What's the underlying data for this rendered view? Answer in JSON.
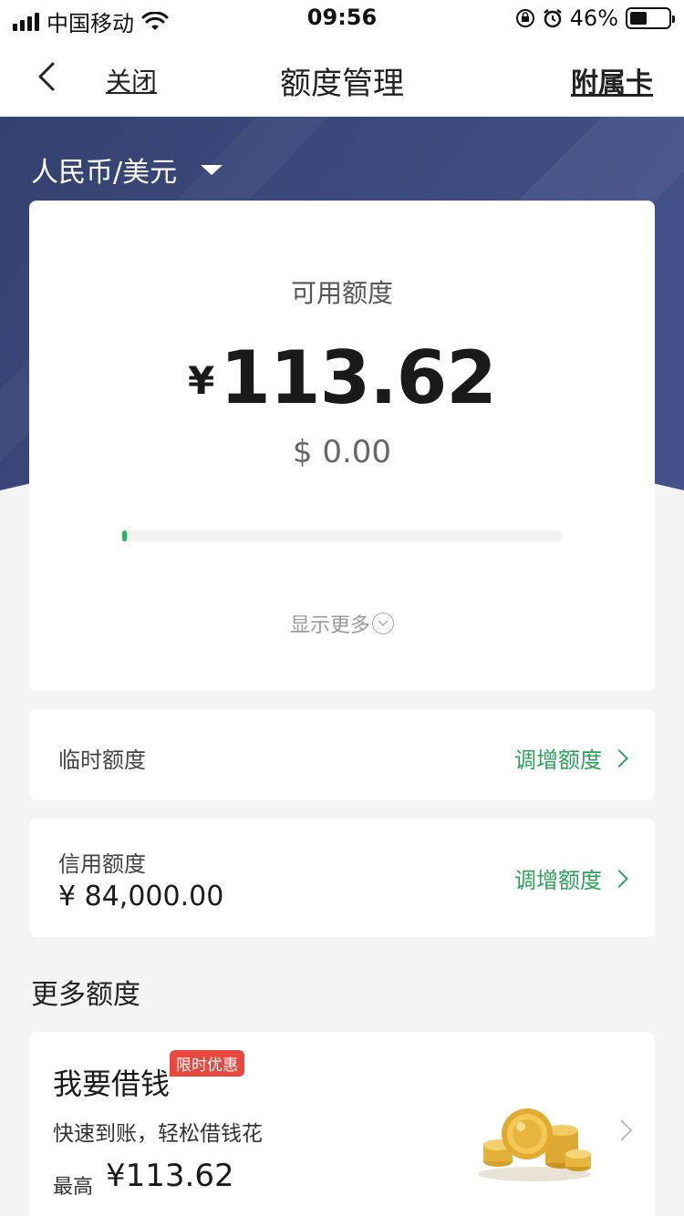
{
  "status_bar": {
    "carrier": "中国移动",
    "time": "09:56",
    "battery_text": "46%",
    "battery_level": 0.46
  },
  "nav": {
    "close_label": "关闭",
    "title": "额度管理",
    "right_label": "附属卡"
  },
  "currency_selector": {
    "label": "人民币/美元"
  },
  "available": {
    "label": "可用额度",
    "currency_symbol": "¥",
    "amount": "113.62",
    "usd_text": "$ 0.00",
    "usage_fraction": 0.01,
    "show_more": "显示更多"
  },
  "temporary": {
    "label": "临时额度",
    "action": "调增额度"
  },
  "credit": {
    "label": "信用额度",
    "value": "¥ 84,000.00",
    "action": "调增额度"
  },
  "more_section": {
    "title": "更多额度"
  },
  "loan": {
    "title": "我要借钱",
    "badge": "限时优惠",
    "subtitle": "快速到账，轻松借钱花",
    "max_label": "最高",
    "max_value": "¥113.62"
  },
  "colors": {
    "hero": "#3a4778",
    "accent_green": "#2aa35a",
    "badge_red": "#e8483e"
  }
}
